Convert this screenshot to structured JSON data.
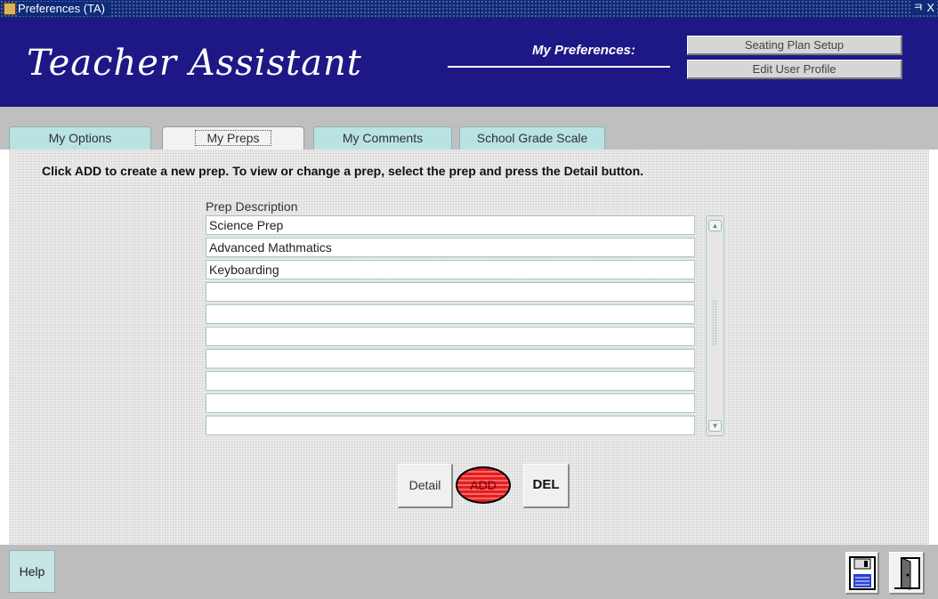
{
  "window": {
    "title": "Preferences (TA)",
    "controls": "ㅋ X"
  },
  "header": {
    "app_name": "Teacher Assistant",
    "section_label": "My Preferences:",
    "buttons": {
      "seating_plan": "Seating Plan Setup",
      "edit_profile": "Edit User Profile"
    }
  },
  "tabs": [
    {
      "label": "My Options"
    },
    {
      "label": "My Preps"
    },
    {
      "label": "My Comments"
    },
    {
      "label": "School Grade Scale"
    }
  ],
  "active_tab": "My Preps",
  "main": {
    "instructions": "Click ADD to create a new prep. To view or change a prep, select the prep and press the Detail button.",
    "column_header": "Prep Description",
    "rows": [
      "Science Prep",
      "Advanced Mathmatics",
      "Keyboarding",
      "",
      "",
      "",
      "",
      "",
      "",
      ""
    ]
  },
  "actions": {
    "detail": "Detail",
    "add": "ADD",
    "del": "DEL"
  },
  "footer": {
    "help": "Help"
  },
  "icons": {
    "save": "floppy-disk-icon",
    "exit": "exit-door-icon",
    "scroll_up": "arrow-up-icon",
    "scroll_down": "arrow-down-icon"
  },
  "colors": {
    "header_bg": "#1e1886",
    "titlebar_bg": "#0f2a78",
    "tab_bg": "#b9e3e3",
    "add_button_red": "#e02020"
  }
}
